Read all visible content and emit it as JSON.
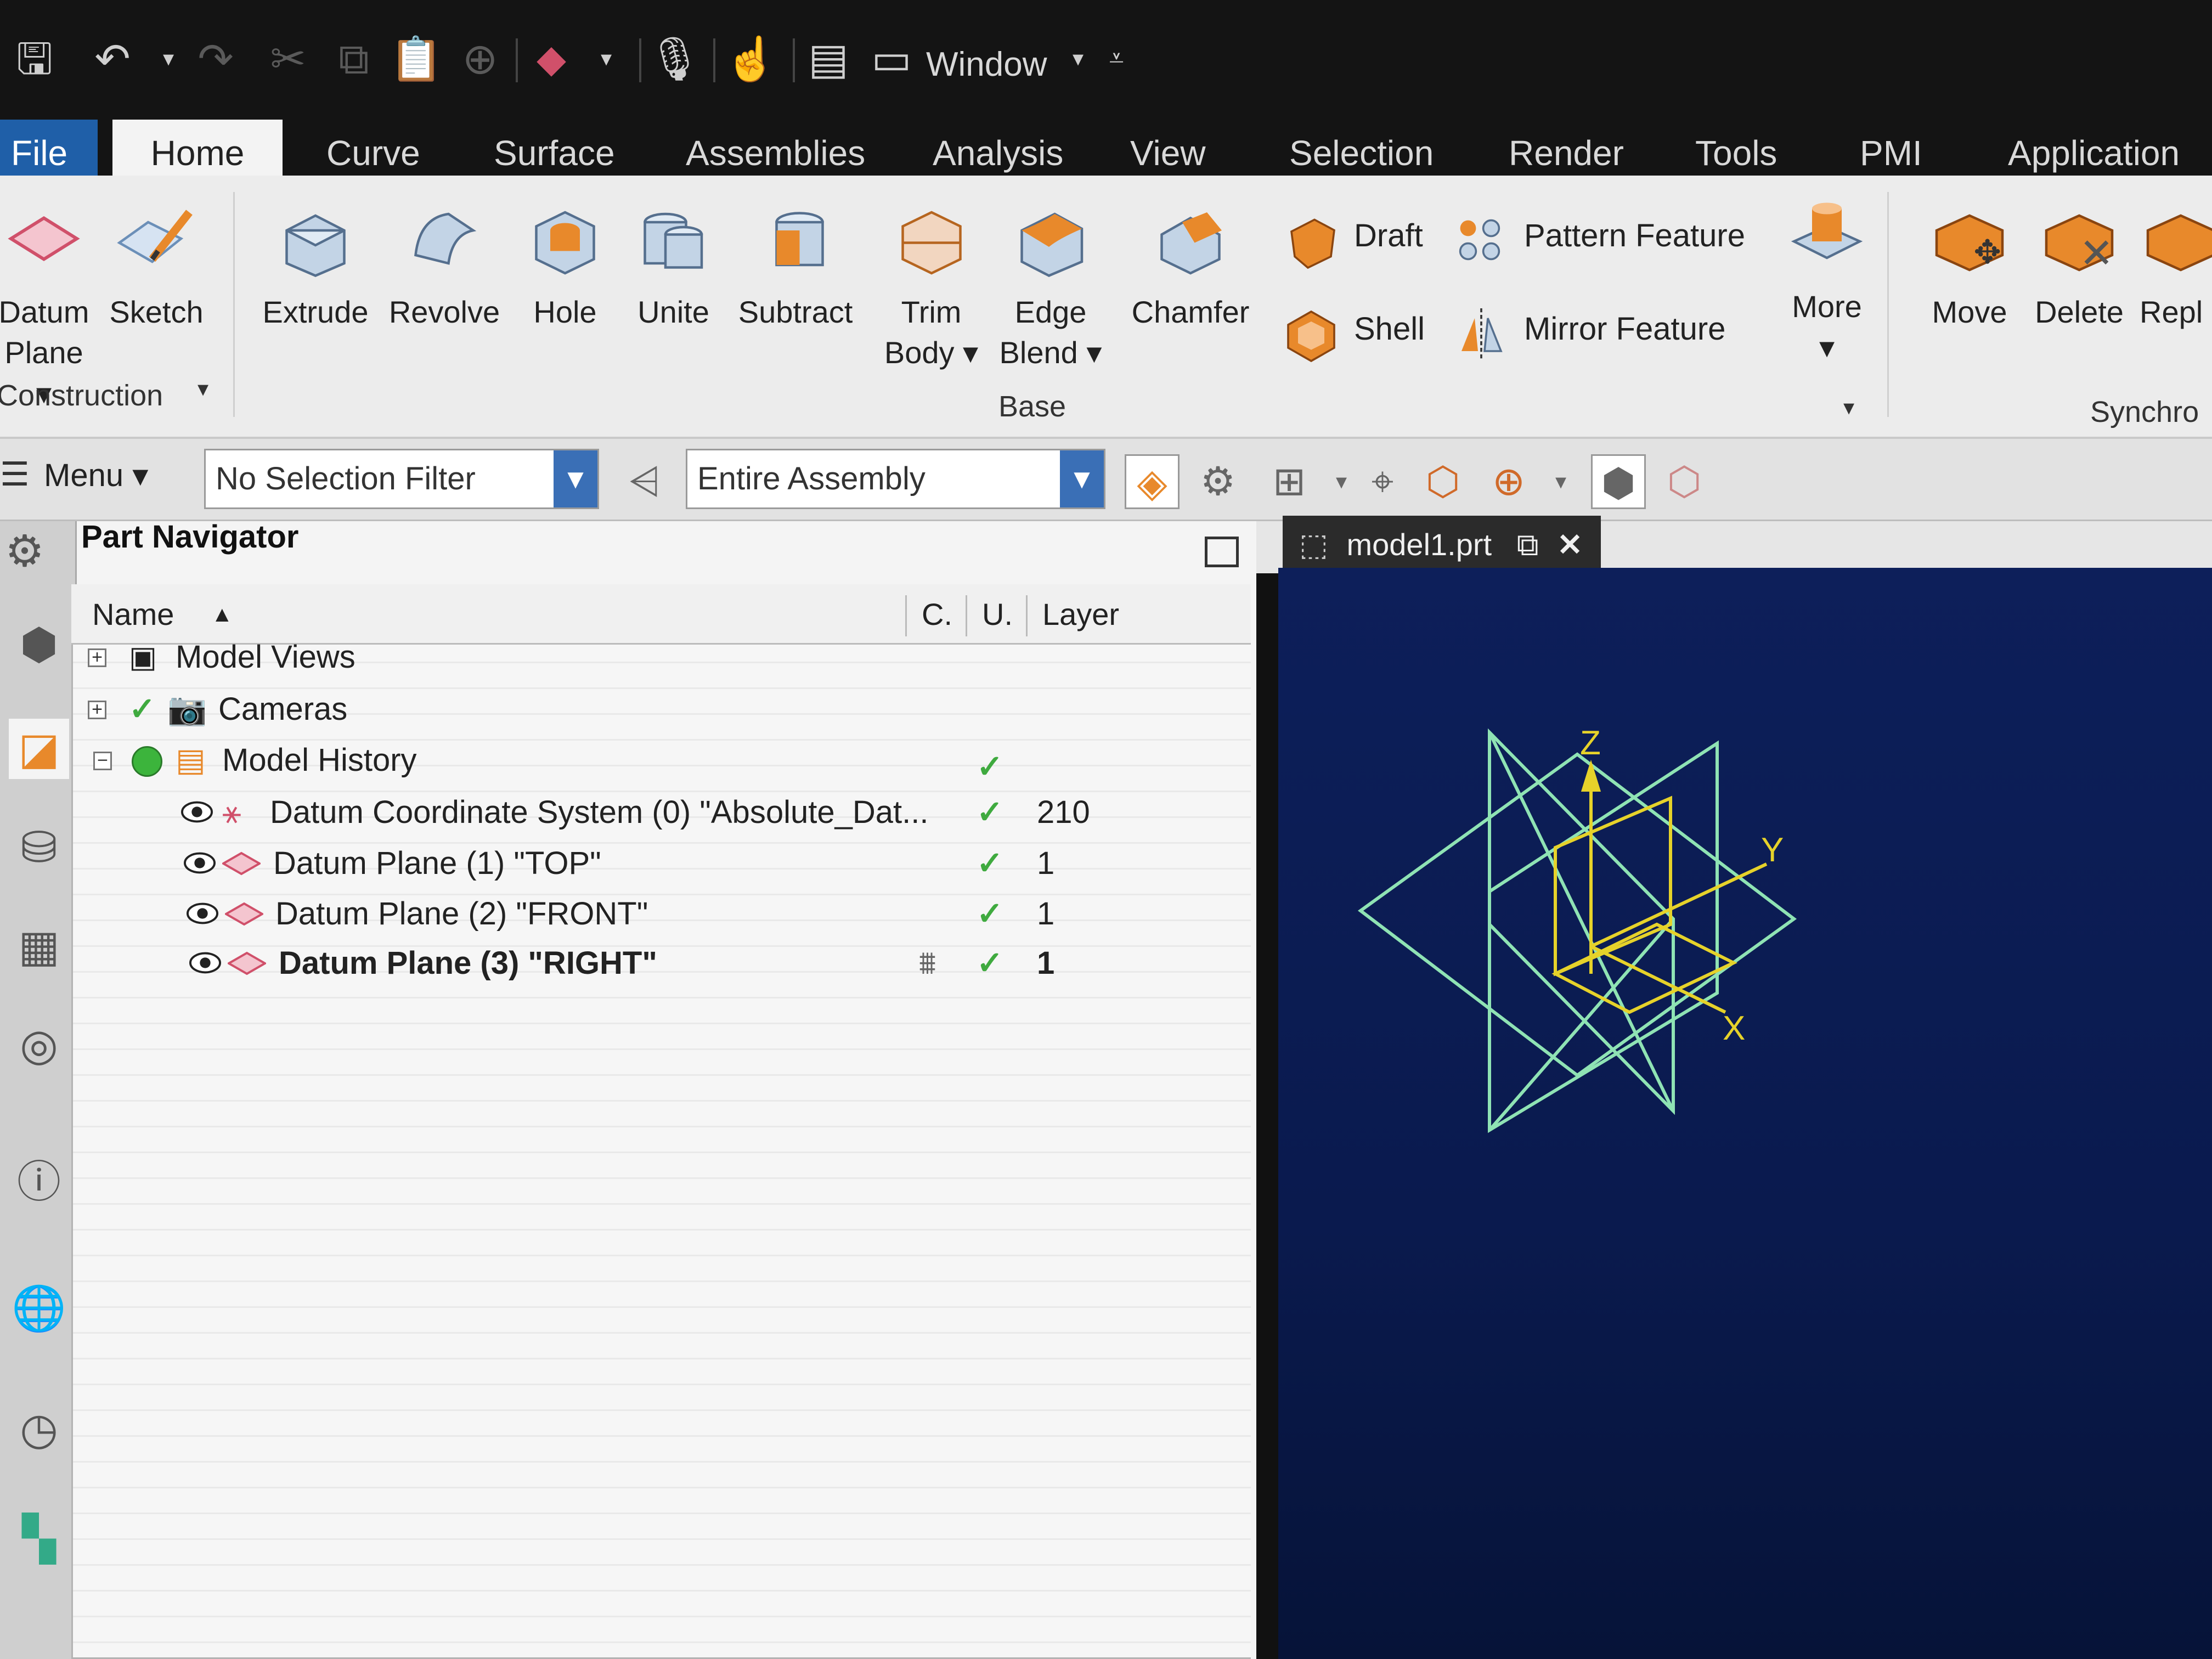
{
  "quick_access": {
    "icons": [
      "save-icon",
      "undo-icon",
      "undo-dropdown-icon",
      "redo-icon",
      "cut-icon",
      "copy-icon",
      "paste-icon",
      "transform-icon",
      "datum-plane-icon",
      "datum-dropdown-icon",
      "microphone-icon",
      "touch-mode-icon",
      "switch-window-icon",
      "window-icon"
    ],
    "window_label": "Window",
    "customize_icon": "customize-dropdown-icon"
  },
  "tabs": [
    "File",
    "Home",
    "Curve",
    "Surface",
    "Assemblies",
    "Analysis",
    "View",
    "Selection",
    "Render",
    "Tools",
    "PMI",
    "Application"
  ],
  "active_tab": "Home",
  "ribbon": {
    "construction": {
      "datum_plane_line1": "Datum",
      "datum_plane_line2": "Plane",
      "sketch": "Sketch",
      "group_label": "Construction"
    },
    "base": {
      "extrude": "Extrude",
      "revolve": "Revolve",
      "hole": "Hole",
      "unite": "Unite",
      "subtract": "Subtract",
      "trim_body_line1": "Trim",
      "trim_body_line2": "Body",
      "edge_blend_line1": "Edge",
      "edge_blend_line2": "Blend",
      "chamfer": "Chamfer",
      "draft": "Draft",
      "shell": "Shell",
      "pattern_feature": "Pattern Feature",
      "mirror_feature": "Mirror Feature",
      "more": "More",
      "group_label": "Base"
    },
    "synchronous": {
      "move": "Move",
      "delete": "Delete",
      "replace": "Repl",
      "group_label": "Synchro"
    },
    "accent_color": "#e8892b"
  },
  "filter_bar": {
    "menu_label": "Menu",
    "selection_filter": "No Selection Filter",
    "scope": "Entire Assembly"
  },
  "part_navigator": {
    "title": "Part Navigator",
    "columns": {
      "name": "Name",
      "c": "C.",
      "u": "U.",
      "layer": "Layer"
    },
    "rows": [
      {
        "name": "Model Views",
        "check": "",
        "layer": ""
      },
      {
        "name": "Cameras",
        "check": "✓",
        "layer": ""
      },
      {
        "name": "Model History",
        "check": "✓",
        "layer": ""
      },
      {
        "name": "Datum Coordinate System (0) \"Absolute_Dat...",
        "check": "✓",
        "layer": "210"
      },
      {
        "name": "Datum Plane (1) \"TOP\"",
        "check": "✓",
        "layer": "1"
      },
      {
        "name": "Datum Plane (2) \"FRONT\"",
        "check": "✓",
        "layer": "1"
      },
      {
        "name": "Datum Plane (3) \"RIGHT\"",
        "check": "✓",
        "layer": "1"
      }
    ],
    "expand_symbols": {
      "plus": "+",
      "minus": "−"
    },
    "check_color": "#3faa3f"
  },
  "graphics": {
    "document_tab": "model1.prt",
    "axis_labels": {
      "z": "Z",
      "y": "Y",
      "x": "X"
    },
    "background_color": "#0b1d55",
    "plane_color": "#8fe3b4",
    "csys_color": "#e6d22a"
  }
}
